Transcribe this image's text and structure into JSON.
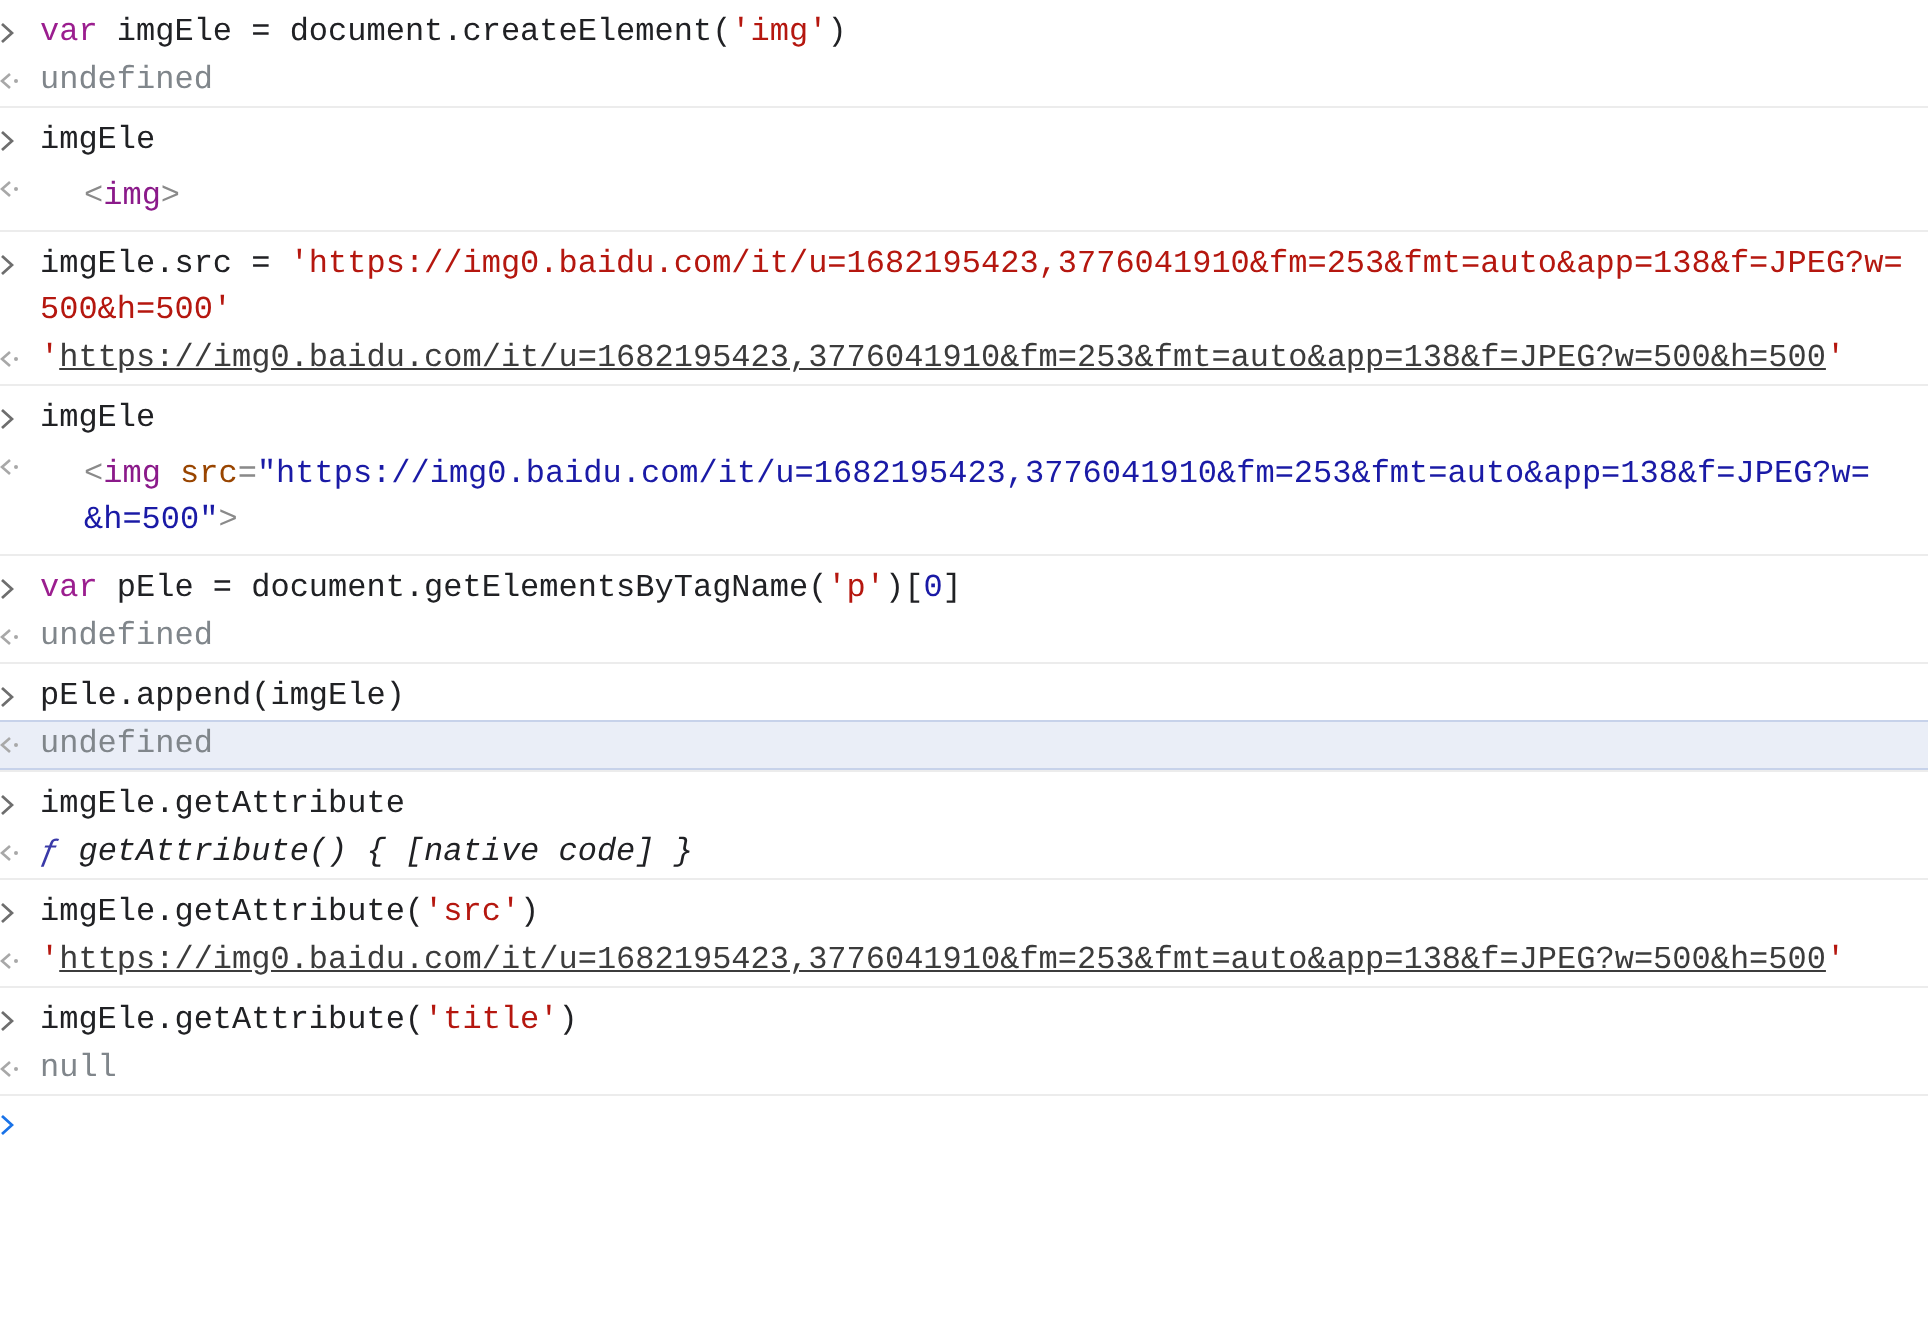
{
  "console": {
    "entries": [
      {
        "input": [
          [
            {
              "kind": "keyword",
              "text": "var"
            },
            {
              "kind": "plain",
              "text": " imgEle = document.createElement("
            },
            {
              "kind": "string",
              "text": "'img'"
            },
            {
              "kind": "plain",
              "text": ")"
            }
          ]
        ],
        "result": {
          "kind": "value",
          "highlighted": false,
          "lines": [
            [
              {
                "kind": "muted",
                "text": "undefined"
              }
            ]
          ]
        }
      },
      {
        "input": [
          [
            {
              "kind": "plain",
              "text": "imgEle"
            }
          ]
        ],
        "result": {
          "kind": "element",
          "highlighted": false,
          "lines": [
            [
              {
                "kind": "punct",
                "text": "<"
              },
              {
                "kind": "tag",
                "text": "img"
              },
              {
                "kind": "punct",
                "text": ">"
              }
            ]
          ]
        }
      },
      {
        "input": [
          [
            {
              "kind": "plain",
              "text": "imgEle.src = "
            },
            {
              "kind": "string",
              "text": "'https://img0.baidu.com/it/u=1682195423,3776041910&fm=253&fmt=auto&app=138&f=JPEG?w=500&h=500'"
            }
          ]
        ],
        "result": {
          "kind": "value",
          "highlighted": false,
          "lines": [
            [
              {
                "kind": "string",
                "text": "'"
              },
              {
                "kind": "link",
                "text": "https://img0.baidu.com/it/u=1682195423,3776041910&fm=253&fmt=auto&app=138&f=JPEG?w=500&h=500"
              },
              {
                "kind": "string",
                "text": "'"
              }
            ]
          ]
        }
      },
      {
        "input": [
          [
            {
              "kind": "plain",
              "text": "imgEle"
            }
          ]
        ],
        "result": {
          "kind": "element",
          "highlighted": false,
          "lines": [
            [
              {
                "kind": "punct",
                "text": "<"
              },
              {
                "kind": "tag",
                "text": "img"
              },
              {
                "kind": "attr",
                "text": " src"
              },
              {
                "kind": "punct",
                "text": "="
              },
              {
                "kind": "attr-value",
                "text": "\"https://img0.baidu.com/it/u=1682195423,3776041910&fm=253&fmt=auto&app=138&f=JPEG?w="
              }
            ],
            [
              {
                "kind": "attr-value",
                "text": "&h=500\""
              },
              {
                "kind": "punct",
                "text": ">"
              }
            ]
          ]
        }
      },
      {
        "input": [
          [
            {
              "kind": "keyword",
              "text": "var"
            },
            {
              "kind": "plain",
              "text": " pEle = document.getElementsByTagName("
            },
            {
              "kind": "string",
              "text": "'p'"
            },
            {
              "kind": "plain",
              "text": ")["
            },
            {
              "kind": "number",
              "text": "0"
            },
            {
              "kind": "plain",
              "text": "]"
            }
          ]
        ],
        "result": {
          "kind": "value",
          "highlighted": false,
          "lines": [
            [
              {
                "kind": "muted",
                "text": "undefined"
              }
            ]
          ]
        }
      },
      {
        "input": [
          [
            {
              "kind": "plain",
              "text": "pEle.append(imgEle)"
            }
          ]
        ],
        "result": {
          "kind": "value",
          "highlighted": true,
          "lines": [
            [
              {
                "kind": "muted",
                "text": "undefined"
              }
            ]
          ]
        }
      },
      {
        "input": [
          [
            {
              "kind": "plain",
              "text": "imgEle.getAttribute"
            }
          ]
        ],
        "result": {
          "kind": "value",
          "highlighted": false,
          "lines": [
            [
              {
                "kind": "fn",
                "text": "ƒ"
              },
              {
                "kind": "italic",
                "text": " getAttribute() { [native code] }"
              }
            ]
          ]
        }
      },
      {
        "input": [
          [
            {
              "kind": "plain",
              "text": "imgEle.getAttribute("
            },
            {
              "kind": "string",
              "text": "'src'"
            },
            {
              "kind": "plain",
              "text": ")"
            }
          ]
        ],
        "result": {
          "kind": "value",
          "highlighted": false,
          "lines": [
            [
              {
                "kind": "string",
                "text": "'"
              },
              {
                "kind": "link",
                "text": "https://img0.baidu.com/it/u=1682195423,3776041910&fm=253&fmt=auto&app=138&f=JPEG?w=500&h=500"
              },
              {
                "kind": "string",
                "text": "'"
              }
            ]
          ]
        }
      },
      {
        "input": [
          [
            {
              "kind": "plain",
              "text": "imgEle.getAttribute("
            },
            {
              "kind": "string",
              "text": "'title'"
            },
            {
              "kind": "plain",
              "text": ")"
            }
          ]
        ],
        "result": {
          "kind": "value",
          "highlighted": false,
          "lines": [
            [
              {
                "kind": "muted",
                "text": "null"
              }
            ]
          ]
        }
      }
    ]
  }
}
